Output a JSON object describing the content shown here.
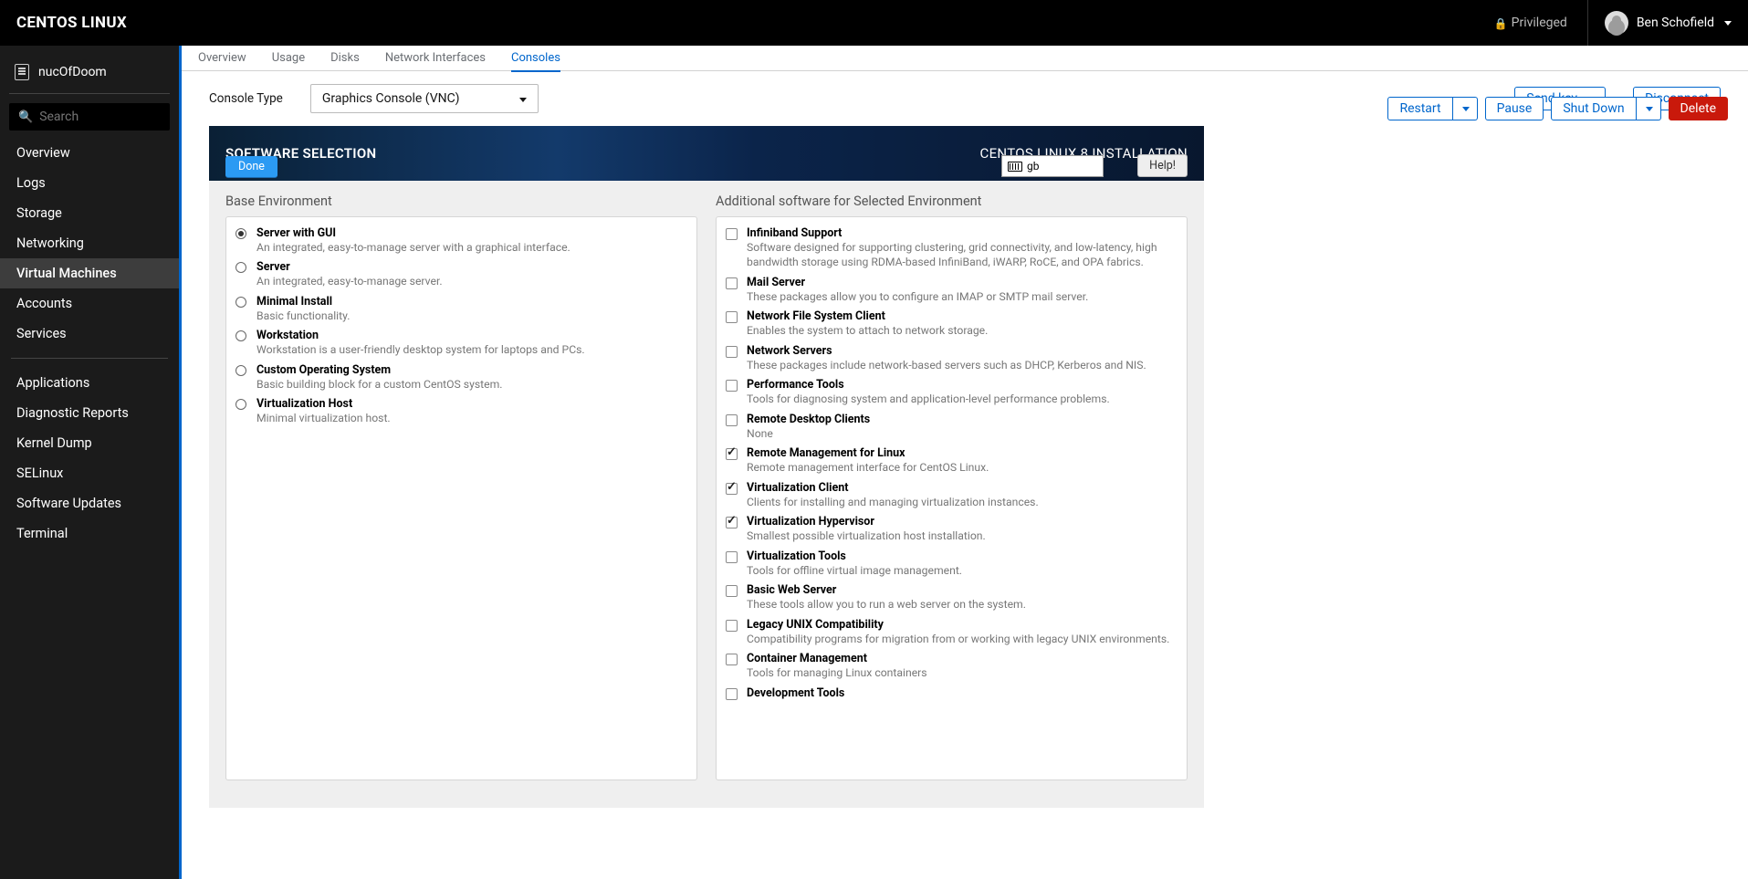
{
  "topbar": {
    "brand": "CENTOS LINUX",
    "privileged": "Privileged",
    "user": "Ben Schofield"
  },
  "sidebar": {
    "host": "nucOfDoom",
    "search_placeholder": "Search",
    "items": [
      {
        "label": "Overview"
      },
      {
        "label": "Logs"
      },
      {
        "label": "Storage"
      },
      {
        "label": "Networking"
      },
      {
        "label": "Virtual Machines",
        "active": true
      },
      {
        "label": "Accounts"
      },
      {
        "label": "Services"
      }
    ],
    "system_items": [
      {
        "label": "Applications"
      },
      {
        "label": "Diagnostic Reports"
      },
      {
        "label": "Kernel Dump"
      },
      {
        "label": "SELinux"
      },
      {
        "label": "Software Updates"
      },
      {
        "label": "Terminal"
      }
    ]
  },
  "tabs": [
    {
      "label": "Overview"
    },
    {
      "label": "Usage"
    },
    {
      "label": "Disks"
    },
    {
      "label": "Network Interfaces"
    },
    {
      "label": "Consoles",
      "active": true
    }
  ],
  "actions": {
    "restart": "Restart",
    "pause": "Pause",
    "shutdown": "Shut Down",
    "delete": "Delete"
  },
  "console_row": {
    "label": "Console Type",
    "value": "Graphics Console (VNC)",
    "send_key": "Send key",
    "disconnect": "Disconnect"
  },
  "vnc": {
    "title": "SOFTWARE SELECTION",
    "done": "Done",
    "install_title": "CENTOS LINUX 8 INSTALLATION",
    "keyboard": "gb",
    "help": "Help!",
    "left_title": "Base Environment",
    "right_title": "Additional software for Selected Environment",
    "base_env": [
      {
        "name": "Server with GUI",
        "desc": "An integrated, easy-to-manage server with a graphical interface.",
        "selected": true
      },
      {
        "name": "Server",
        "desc": "An integrated, easy-to-manage server."
      },
      {
        "name": "Minimal Install",
        "desc": "Basic functionality."
      },
      {
        "name": "Workstation",
        "desc": "Workstation is a user-friendly desktop system for laptops and PCs."
      },
      {
        "name": "Custom Operating System",
        "desc": "Basic building block for a custom CentOS system."
      },
      {
        "name": "Virtualization Host",
        "desc": "Minimal virtualization host."
      }
    ],
    "addons": [
      {
        "name": "Infiniband Support",
        "desc": "Software designed for supporting clustering, grid connectivity, and low-latency, high bandwidth storage using RDMA-based InfiniBand, iWARP, RoCE, and OPA fabrics."
      },
      {
        "name": "Mail Server",
        "desc": "These packages allow you to configure an IMAP or SMTP mail server."
      },
      {
        "name": "Network File System Client",
        "desc": "Enables the system to attach to network storage."
      },
      {
        "name": "Network Servers",
        "desc": "These packages include network-based servers such as DHCP, Kerberos and NIS."
      },
      {
        "name": "Performance Tools",
        "desc": "Tools for diagnosing system and application-level performance problems."
      },
      {
        "name": "Remote Desktop Clients",
        "desc": "None"
      },
      {
        "name": "Remote Management for Linux",
        "desc": "Remote management interface for CentOS Linux.",
        "checked": true
      },
      {
        "name": "Virtualization Client",
        "desc": "Clients for installing and managing virtualization instances.",
        "checked": true
      },
      {
        "name": "Virtualization Hypervisor",
        "desc": "Smallest possible virtualization host installation.",
        "checked": true
      },
      {
        "name": "Virtualization Tools",
        "desc": "Tools for offline virtual image management."
      },
      {
        "name": "Basic Web Server",
        "desc": "These tools allow you to run a web server on the system."
      },
      {
        "name": "Legacy UNIX Compatibility",
        "desc": "Compatibility programs for migration from or working with legacy UNIX environments."
      },
      {
        "name": "Container Management",
        "desc": "Tools for managing Linux containers"
      },
      {
        "name": "Development Tools",
        "desc": ""
      }
    ]
  }
}
